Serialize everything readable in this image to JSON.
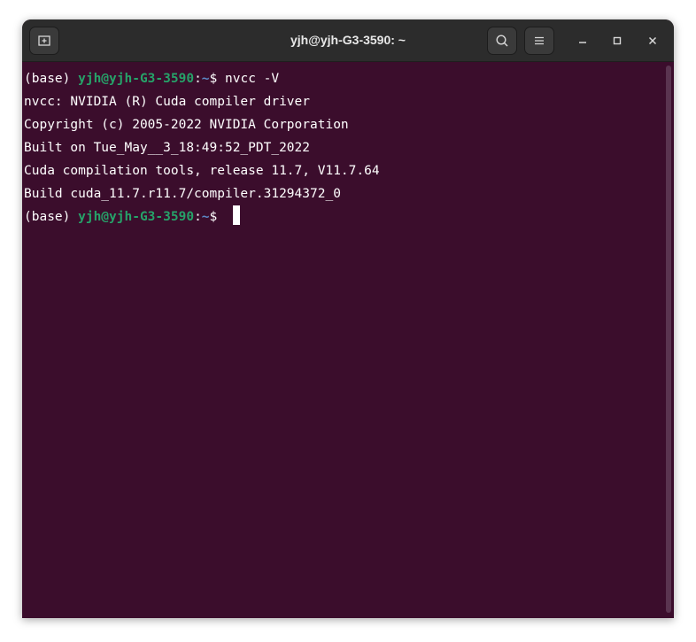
{
  "window": {
    "title": "yjh@yjh-G3-3590: ~"
  },
  "titlebar": {
    "new_tab_icon": "new-tab-icon",
    "search_icon": "search-icon",
    "menu_icon": "hamburger-menu-icon",
    "minimize_icon": "minimize-icon",
    "maximize_icon": "maximize-icon",
    "close_icon": "close-icon"
  },
  "terminal": {
    "prompt_env": "(base) ",
    "prompt_user": "yjh@yjh-G3-3590",
    "prompt_colon": ":",
    "prompt_path": "~",
    "prompt_symbol": "$ ",
    "command": "nvcc -V",
    "output": [
      "nvcc: NVIDIA (R) Cuda compiler driver",
      "Copyright (c) 2005-2022 NVIDIA Corporation",
      "Built on Tue_May__3_18:49:52_PDT_2022",
      "Cuda compilation tools, release 11.7, V11.7.64",
      "Build cuda_11.7.r11.7/compiler.31294372_0"
    ]
  },
  "colors": {
    "background": "#3b0d2c",
    "titlebar": "#2c2c2c",
    "prompt_user": "#26a269",
    "prompt_path": "#5c88c6",
    "text": "#ffffff"
  }
}
